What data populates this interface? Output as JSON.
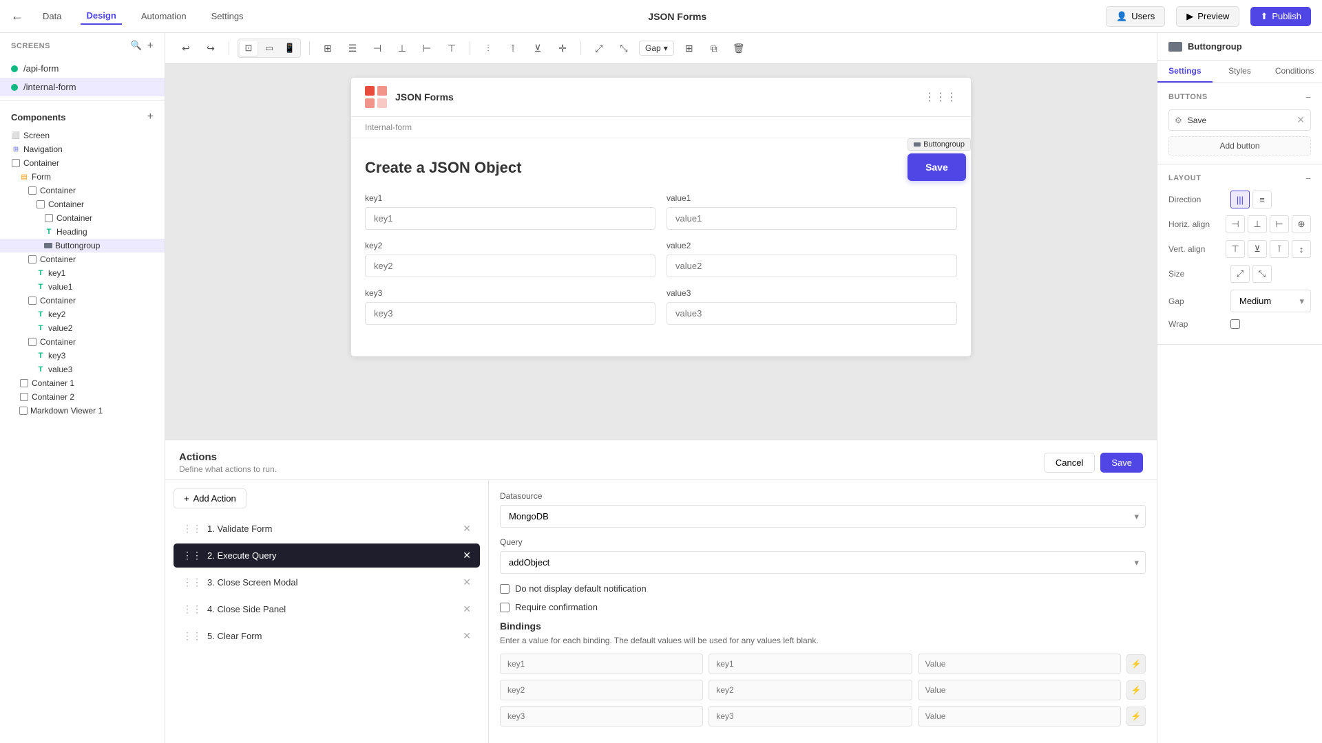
{
  "topNav": {
    "backBtn": "←",
    "tabs": [
      "Data",
      "Design",
      "Automation",
      "Settings"
    ],
    "activeTab": "Design",
    "appTitle": "JSON Forms",
    "userBtn": "Users",
    "previewBtn": "Preview",
    "publishBtn": "Publish"
  },
  "leftSidebar": {
    "screensLabel": "Screens",
    "screens": [
      {
        "name": "/api-form",
        "active": false
      },
      {
        "name": "/internal-form",
        "active": true
      }
    ],
    "componentsLabel": "Components",
    "treeItems": [
      {
        "level": 1,
        "icon": "screen",
        "label": "Screen"
      },
      {
        "level": 1,
        "icon": "nav",
        "label": "Navigation"
      },
      {
        "level": 1,
        "icon": "container",
        "label": "Container"
      },
      {
        "level": 2,
        "icon": "form",
        "label": "Form"
      },
      {
        "level": 3,
        "icon": "container",
        "label": "Container"
      },
      {
        "level": 4,
        "icon": "container",
        "label": "Container"
      },
      {
        "level": 5,
        "icon": "container",
        "label": "Container"
      },
      {
        "level": 6,
        "icon": "T",
        "label": "Heading"
      },
      {
        "level": 6,
        "icon": "buttongroup",
        "label": "Buttongroup",
        "selected": true
      },
      {
        "level": 3,
        "icon": "container",
        "label": "Container"
      },
      {
        "level": 4,
        "icon": "T",
        "label": "key1"
      },
      {
        "level": 4,
        "icon": "T",
        "label": "value1"
      },
      {
        "level": 3,
        "icon": "container",
        "label": "Container"
      },
      {
        "level": 4,
        "icon": "T",
        "label": "key2"
      },
      {
        "level": 4,
        "icon": "T",
        "label": "value2"
      },
      {
        "level": 3,
        "icon": "container",
        "label": "Container"
      },
      {
        "level": 4,
        "icon": "T",
        "label": "key3"
      },
      {
        "level": 4,
        "icon": "T",
        "label": "value3"
      },
      {
        "level": 2,
        "icon": "container",
        "label": "Container 1"
      },
      {
        "level": 2,
        "icon": "container",
        "label": "Container 2"
      },
      {
        "level": 2,
        "icon": "markdown",
        "label": "Markdown Viewer 1"
      }
    ]
  },
  "canvas": {
    "undoBtn": "↩",
    "redoBtn": "↪",
    "breadcrumb": "Internal-form",
    "appName": "JSON Forms",
    "formTitle": "Create a JSON Object",
    "fields": [
      {
        "key": "key1",
        "value": "value1"
      },
      {
        "key": "key2",
        "value": "value2"
      },
      {
        "key": "key3",
        "value": "value3"
      }
    ],
    "saveButtonLabel": "Save",
    "buttongroupLabel": "Buttongroup"
  },
  "actionsPanel": {
    "title": "Actions",
    "subtitle": "Define what actions to run.",
    "cancelBtn": "Cancel",
    "saveBtn": "Save",
    "addActionBtn": "Add Action",
    "actions": [
      {
        "id": 1,
        "name": "1. Validate Form",
        "selected": false
      },
      {
        "id": 2,
        "name": "2. Execute Query",
        "selected": true
      },
      {
        "id": 3,
        "name": "3. Close Screen Modal",
        "selected": false
      },
      {
        "id": 4,
        "name": "4. Close Side Panel",
        "selected": false
      },
      {
        "id": 5,
        "name": "5. Clear Form",
        "selected": false
      }
    ],
    "datasourceLabel": "Datasource",
    "datasourceValue": "MongoDB",
    "queryLabel": "Query",
    "queryValue": "addObject",
    "checkboxNotification": "Do not display default notification",
    "checkboxConfirmation": "Require confirmation",
    "bindingsTitle": "Bindings",
    "bindingsDesc": "Enter a value for each binding. The default values will be used for any values left blank.",
    "bindingRows": [
      {
        "left": "key1",
        "middle": "key1",
        "right": "Value"
      },
      {
        "left": "key2",
        "middle": "key2",
        "right": "Value"
      },
      {
        "left": "key3",
        "middle": "key3",
        "right": "Value"
      }
    ]
  },
  "rightPanel": {
    "componentName": "Buttongroup",
    "tabs": [
      "Settings",
      "Styles",
      "Conditions"
    ],
    "activeTab": "Settings",
    "buttonsSectionTitle": "BUTTONS",
    "buttonLabel": "Save",
    "addButtonLabel": "Add button",
    "layoutSectionTitle": "LAYOUT",
    "directionLabel": "Direction",
    "horizAlignLabel": "Horiz. align",
    "vertAlignLabel": "Vert. align",
    "sizeLabel": "Size",
    "gapLabel": "Gap",
    "gapValue": "Medium",
    "wrapLabel": "Wrap"
  }
}
